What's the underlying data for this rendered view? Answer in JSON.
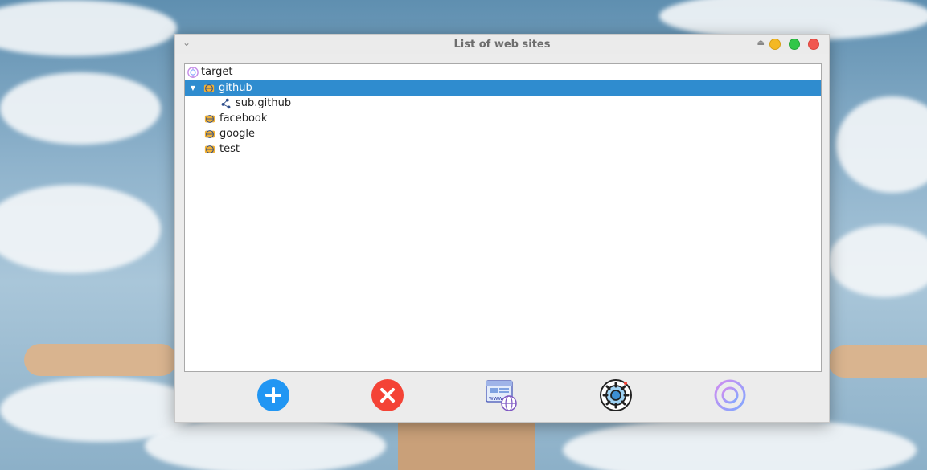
{
  "window": {
    "title": "List of web sites"
  },
  "tree": {
    "root": {
      "label": "target",
      "icon": "target-icon"
    },
    "items": [
      {
        "label": "github",
        "icon": "website-icon",
        "expanded": true,
        "selected": true
      },
      {
        "label": "sub.github",
        "icon": "network-nodes-icon"
      },
      {
        "label": "facebook",
        "icon": "website-icon"
      },
      {
        "label": "google",
        "icon": "website-icon"
      },
      {
        "label": "test",
        "icon": "website-icon"
      }
    ]
  },
  "toolbar": {
    "buttons": [
      {
        "name": "add-button",
        "icon": "plus-circle-icon",
        "color": "#2196f3"
      },
      {
        "name": "delete-button",
        "icon": "x-circle-icon",
        "color": "#f44336"
      },
      {
        "name": "websites-button",
        "icon": "www-globe-icon",
        "color": "#5c6bc0"
      },
      {
        "name": "settings-button",
        "icon": "gear-icon",
        "color": "#3c8fd4"
      },
      {
        "name": "target-button",
        "icon": "target-crosshair-icon",
        "color": "#b388ff"
      }
    ]
  },
  "colors": {
    "selection": "#2f8ccf",
    "window_bg": "#ececec"
  }
}
